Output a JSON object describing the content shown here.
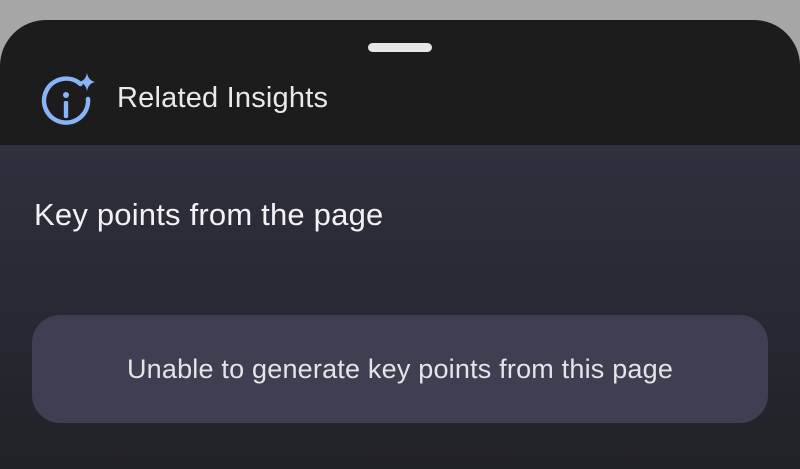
{
  "header": {
    "title": "Related Insights",
    "icon": "insights-sparkle-info-icon",
    "icon_color": "#8ab4f8"
  },
  "section": {
    "heading": "Key points from the page"
  },
  "message": {
    "text": "Unable to generate key points from this page"
  },
  "colors": {
    "sheet_bg": "#1c1c1d",
    "content_bg": "#2b2c38",
    "card_bg": "#3e3f50",
    "accent": "#8ab4f8"
  }
}
